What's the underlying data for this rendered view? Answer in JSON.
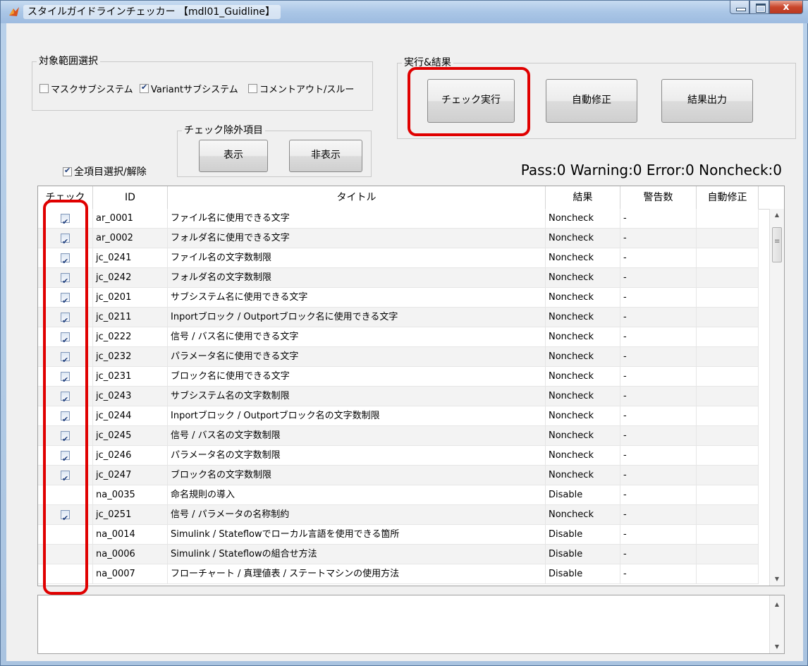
{
  "window": {
    "title": "スタイルガイドラインチェッカー 【mdl01_Guidline】",
    "close_label": "x"
  },
  "scope": {
    "legend": "対象範囲選択",
    "options": [
      {
        "label": "マスクサブシステム",
        "checked": false
      },
      {
        "label": "Variantサブシステム",
        "checked": true
      },
      {
        "label": "コメントアウト/スルー",
        "checked": false
      }
    ]
  },
  "exclude": {
    "legend": "チェック除外項目",
    "show_label": "表示",
    "hide_label": "非表示"
  },
  "select_all": {
    "label": "全項目選択/解除",
    "checked": true
  },
  "run": {
    "legend": "実行&結果",
    "check_label": "チェック実行",
    "autofix_label": "自動修正",
    "export_label": "結果出力"
  },
  "status": "Pass:0 Warning:0 Error:0 Noncheck:0",
  "table": {
    "headers": [
      "チェック",
      "ID",
      "タイトル",
      "結果",
      "警告数",
      "自動修正"
    ],
    "rows": [
      {
        "checked": true,
        "id": "ar_0001",
        "title": "ファイル名に使用できる文字",
        "result": "Noncheck",
        "warnings": "-",
        "autofix": ""
      },
      {
        "checked": true,
        "id": "ar_0002",
        "title": "フォルダ名に使用できる文字",
        "result": "Noncheck",
        "warnings": "-",
        "autofix": ""
      },
      {
        "checked": true,
        "id": "jc_0241",
        "title": "ファイル名の文字数制限",
        "result": "Noncheck",
        "warnings": "-",
        "autofix": ""
      },
      {
        "checked": true,
        "id": "jc_0242",
        "title": "フォルダ名の文字数制限",
        "result": "Noncheck",
        "warnings": "-",
        "autofix": ""
      },
      {
        "checked": true,
        "id": "jc_0201",
        "title": "サブシステム名に使用できる文字",
        "result": "Noncheck",
        "warnings": "-",
        "autofix": ""
      },
      {
        "checked": true,
        "id": "jc_0211",
        "title": "Inportブロック / Outportブロック名に使用できる文字",
        "result": "Noncheck",
        "warnings": "-",
        "autofix": ""
      },
      {
        "checked": true,
        "id": "jc_0222",
        "title": "信号 / バス名に使用できる文字",
        "result": "Noncheck",
        "warnings": "-",
        "autofix": ""
      },
      {
        "checked": true,
        "id": "jc_0232",
        "title": "パラメータ名に使用できる文字",
        "result": "Noncheck",
        "warnings": "-",
        "autofix": ""
      },
      {
        "checked": true,
        "id": "jc_0231",
        "title": "ブロック名に使用できる文字",
        "result": "Noncheck",
        "warnings": "-",
        "autofix": ""
      },
      {
        "checked": true,
        "id": "jc_0243",
        "title": "サブシステム名の文字数制限",
        "result": "Noncheck",
        "warnings": "-",
        "autofix": ""
      },
      {
        "checked": true,
        "id": "jc_0244",
        "title": "Inportブロック / Outportブロック名の文字数制限",
        "result": "Noncheck",
        "warnings": "-",
        "autofix": ""
      },
      {
        "checked": true,
        "id": "jc_0245",
        "title": "信号 / バス名の文字数制限",
        "result": "Noncheck",
        "warnings": "-",
        "autofix": ""
      },
      {
        "checked": true,
        "id": "jc_0246",
        "title": "パラメータ名の文字数制限",
        "result": "Noncheck",
        "warnings": "-",
        "autofix": ""
      },
      {
        "checked": true,
        "id": "jc_0247",
        "title": "ブロック名の文字数制限",
        "result": "Noncheck",
        "warnings": "-",
        "autofix": ""
      },
      {
        "checked": false,
        "id": "na_0035",
        "title": "命名規則の導入",
        "result": "Disable",
        "warnings": "-",
        "autofix": ""
      },
      {
        "checked": true,
        "id": "jc_0251",
        "title": "信号 / パラメータの名称制約",
        "result": "Noncheck",
        "warnings": "-",
        "autofix": ""
      },
      {
        "checked": false,
        "id": "na_0014",
        "title": "Simulink / Stateflowでローカル言語を使用できる箇所",
        "result": "Disable",
        "warnings": "-",
        "autofix": ""
      },
      {
        "checked": false,
        "id": "na_0006",
        "title": "Simulink / Stateflowの組合せ方法",
        "result": "Disable",
        "warnings": "-",
        "autofix": ""
      },
      {
        "checked": false,
        "id": "na_0007",
        "title": "フローチャート / 真理値表 / ステートマシンの使用方法",
        "result": "Disable",
        "warnings": "-",
        "autofix": ""
      }
    ]
  },
  "message_box": {
    "text": ""
  },
  "colors": {
    "highlight": "#e00000",
    "titlebar": "#aac6e6",
    "client": "#f0f0f0"
  }
}
